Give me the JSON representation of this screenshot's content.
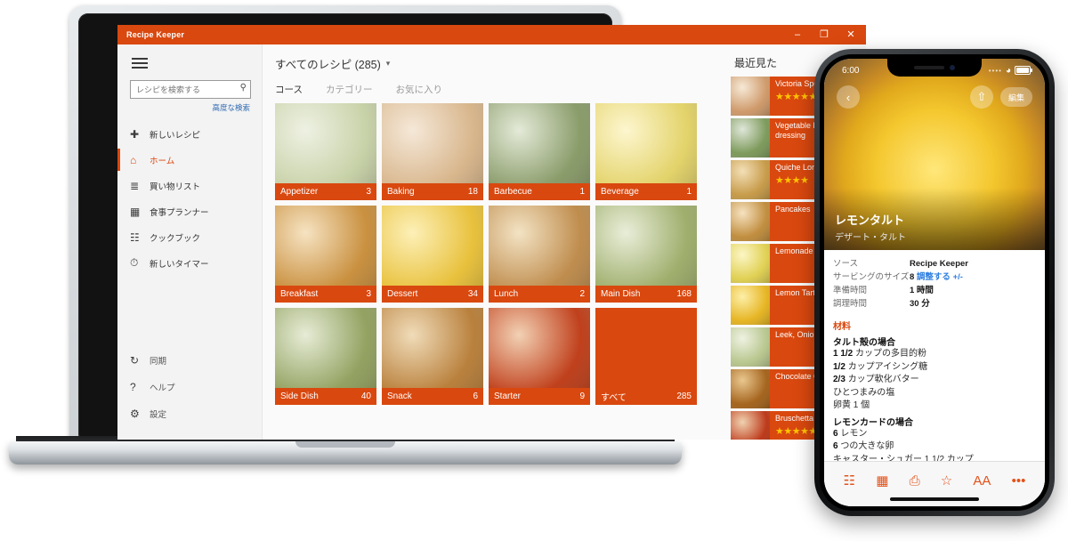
{
  "desktop": {
    "window_title": "Recipe Keeper",
    "window_controls": {
      "minimize": "–",
      "maximize": "❐",
      "close": "✕"
    },
    "sidebar": {
      "menu_icon": "hamburger-icon",
      "search_placeholder": "レシピを検索する",
      "search_value": "",
      "advanced_search": "高度な検索",
      "items": [
        {
          "label": "新しいレシピ",
          "icon": "plus-icon"
        },
        {
          "label": "ホーム",
          "icon": "home-icon"
        },
        {
          "label": "買い物リスト",
          "icon": "list-icon"
        },
        {
          "label": "食事プランナー",
          "icon": "calendar-icon"
        },
        {
          "label": "クックブック",
          "icon": "book-icon"
        },
        {
          "label": "新しいタイマー",
          "icon": "clock-icon"
        }
      ],
      "bottom_items": [
        {
          "label": "同期",
          "icon": "sync-icon"
        },
        {
          "label": "ヘルプ",
          "icon": "question-icon"
        },
        {
          "label": "設定",
          "icon": "gear-icon"
        }
      ]
    },
    "main": {
      "page_title": "すべてのレシピ (285)",
      "dropdown_icon": "chevron-down-icon",
      "tabs": [
        {
          "label": "コース",
          "active": true
        },
        {
          "label": "カテゴリー",
          "active": false
        },
        {
          "label": "お気に入り",
          "active": false
        }
      ],
      "tiles": [
        {
          "name": "Appetizer",
          "count": "3",
          "c1": "#eef1e3",
          "c2": "#c8d2a8"
        },
        {
          "name": "Baking",
          "count": "18",
          "c1": "#f5e8d8",
          "c2": "#d8b68c"
        },
        {
          "name": "Barbecue",
          "count": "1",
          "c1": "#e4ead8",
          "c2": "#8a9c6a"
        },
        {
          "name": "Beverage",
          "count": "1",
          "c1": "#fdf6cf",
          "c2": "#e3d36a"
        },
        {
          "name": "Breakfast",
          "count": "3",
          "c1": "#f6e3c2",
          "c2": "#c9903f"
        },
        {
          "name": "Dessert",
          "count": "34",
          "c1": "#fdf0b8",
          "c2": "#e8c13c"
        },
        {
          "name": "Lunch",
          "count": "2",
          "c1": "#f3e3c4",
          "c2": "#bf8d4e"
        },
        {
          "name": "Main Dish",
          "count": "168",
          "c1": "#e9eed9",
          "c2": "#9fae6c"
        },
        {
          "name": "Side Dish",
          "count": "40",
          "c1": "#e6ecd6",
          "c2": "#93a261"
        },
        {
          "name": "Snack",
          "count": "6",
          "c1": "#f0dcb9",
          "c2": "#b9803c"
        },
        {
          "name": "Starter",
          "count": "9",
          "c1": "#f2d1b4",
          "c2": "#c0401c"
        },
        {
          "name": "すべて",
          "count": "285",
          "c1": "#d9480f",
          "c2": "#d9480f"
        }
      ]
    },
    "recent": {
      "heading": "最近見た",
      "items": [
        {
          "name": "Victoria Sponge",
          "stars": "★★★★★",
          "c1": "#f6e9d6",
          "c2": "#cf9a6b"
        },
        {
          "name": "Vegetable kebabs with dressing",
          "stars": "",
          "c1": "#dfe6d8",
          "c2": "#7e9b5c"
        },
        {
          "name": "Quiche Lorraine",
          "stars": "★★★★",
          "c1": "#f3dfb6",
          "c2": "#c79b4a"
        },
        {
          "name": "Pancakes",
          "stars": "",
          "c1": "#f6e2c0",
          "c2": "#c18e3f"
        },
        {
          "name": "Lemonade",
          "stars": "",
          "c1": "#fcf6c6",
          "c2": "#e0d053"
        },
        {
          "name": "Lemon Tart",
          "stars": "",
          "c1": "#fdefa8",
          "c2": "#e6b524"
        },
        {
          "name": "Leek, Onion and Potato",
          "stars": "",
          "c1": "#eef2e2",
          "c2": "#b9c78f"
        },
        {
          "name": "Chocolate Chip Cookies",
          "stars": "",
          "c1": "#e9c78f",
          "c2": "#a5651f"
        },
        {
          "name": "Bruschetta",
          "stars": "★★★★★",
          "c1": "#f0d2b0",
          "c2": "#bd3a1b"
        }
      ]
    }
  },
  "phone": {
    "status": {
      "time": "6:00",
      "signal_icon": "signal-dots-icon",
      "wifi_icon": "wifi-icon",
      "battery_icon": "battery-icon"
    },
    "back_icon": "chevron-left-icon",
    "share_icon": "share-icon",
    "edit_label": "編集",
    "recipe": {
      "title": "レモンタルト",
      "subtitle": "デザート・タルト",
      "fields": [
        {
          "key": "ソース",
          "value": "Recipe Keeper",
          "link": "",
          "suffix": ""
        },
        {
          "key": "サービングのサイズ",
          "value": "8",
          "link": "調整する",
          "suffix": "+/-"
        },
        {
          "key": "準備時間",
          "value": "1 時間",
          "link": "",
          "suffix": ""
        },
        {
          "key": "調理時間",
          "value": "30 分",
          "link": "",
          "suffix": ""
        }
      ],
      "ingredients_heading": "材料",
      "groups": [
        {
          "name": "タルト殻の場合",
          "items": [
            "1 1/2 カップの多目的粉",
            "1/2 カップアイシング糖",
            "2/3 カップ軟化バター",
            "ひとつまみの塩",
            "卵黄 1 個"
          ]
        },
        {
          "name": "レモンカードの場合",
          "items": [
            "6 レモン",
            "6 つの大きな卵",
            "キャスター・シュガー 1 1/2 カップ"
          ]
        }
      ]
    },
    "tabbar": [
      {
        "icon": "checklist-icon",
        "glyph": "☷"
      },
      {
        "icon": "calendar-icon",
        "glyph": "▦"
      },
      {
        "icon": "print-icon",
        "glyph": "⎙"
      },
      {
        "icon": "star-icon",
        "glyph": "☆"
      },
      {
        "icon": "text-size-icon",
        "glyph": "AA"
      },
      {
        "icon": "more-icon",
        "glyph": "•••"
      }
    ]
  },
  "theme": {
    "accent": "#d9480f",
    "link": "#2f7fe0",
    "star": "#ffc400"
  }
}
